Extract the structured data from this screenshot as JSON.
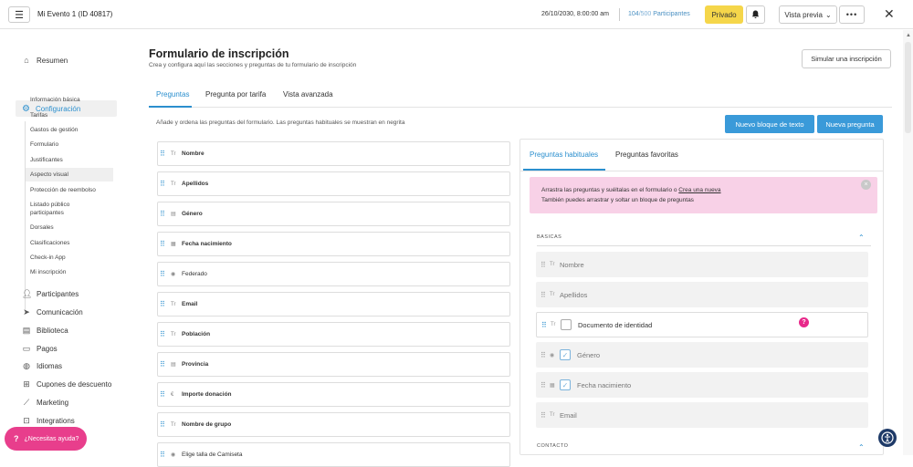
{
  "header": {
    "menu_icon": "hamburger-icon",
    "event_title": "Mi Evento 1 (ID 40817)",
    "datetime": "26/10/2030, 8:00:00 am",
    "participants_current": "104",
    "participants_total": "/500",
    "participants_label": "Participantes",
    "private_label": "Privado",
    "preview_label": "Vista previa",
    "more_label": "•••",
    "close_label": "✕"
  },
  "sidebar": {
    "resumen": "Resumen",
    "configuracion": "Configuración",
    "subitems": [
      "Información básica",
      "Tarifas",
      "Gastos de gestión",
      "Formulario",
      "Justificantes",
      "Aspecto visual",
      "Protección de reembolso",
      "Listado público",
      "participantes",
      "Dorsales",
      "Clasificaciones",
      "Check-in App",
      "Mi inscripción"
    ],
    "items": [
      "Participantes",
      "Comunicación",
      "Biblioteca",
      "Pagos",
      "Idiomas",
      "Cupones de descuento",
      "Marketing",
      "Integrations"
    ],
    "help": "¿Necesitas ayuda?"
  },
  "main": {
    "title": "Formulario de inscripción",
    "subtitle": "Crea y configura aquí las secciones y preguntas de tu formulario de inscripción",
    "simulate_button": "Simular una inscripción",
    "tabs": [
      "Preguntas",
      "Pregunta por tarifa",
      "Vista avanzada"
    ],
    "instruction": "Añade y ordena las preguntas del formulario. Las preguntas habituales se muestran en negrita",
    "new_text_block": "Nuevo bloque de texto",
    "new_question": "Nueva pregunta",
    "badge": "?",
    "left_questions": [
      {
        "label": "Nombre",
        "icon": "Tr",
        "bold": true
      },
      {
        "label": "Apellidos",
        "icon": "Tr",
        "bold": true
      },
      {
        "label": "Género",
        "icon": "▤",
        "bold": true
      },
      {
        "label": "Fecha nacimiento",
        "icon": "▦",
        "bold": true
      },
      {
        "label": "Federado",
        "icon": "◉",
        "bold": false
      },
      {
        "label": "Email",
        "icon": "Tr",
        "bold": true
      },
      {
        "label": "Población",
        "icon": "Tr",
        "bold": true
      },
      {
        "label": "Provincia",
        "icon": "▤",
        "bold": true
      },
      {
        "label": "Importe donación",
        "icon": "€",
        "bold": true
      },
      {
        "label": "Nombre de grupo",
        "icon": "Tr",
        "bold": true
      },
      {
        "label": "Elige talla de Camiseta",
        "icon": "◉",
        "bold": false
      }
    ]
  },
  "right_panel": {
    "tabs": [
      "Preguntas habituales",
      "Preguntas favoritas"
    ],
    "info_line1": "Arrastra las preguntas y suéltalas en el formulario o ",
    "info_link": "Crea una nueva",
    "info_line2": "También puedes arrastrar y soltar un bloque de preguntas",
    "close": "×",
    "section_basicas": "BASICAS",
    "section_contacto": "CONTACTO",
    "questions": [
      {
        "label": "Nombre",
        "icon": "Tr",
        "checkbox": false,
        "active": false
      },
      {
        "label": "Apellidos",
        "icon": "Tr",
        "checkbox": false,
        "active": false
      },
      {
        "label": "Documento de identidad",
        "icon": "Tr",
        "checkbox": true,
        "checked": false,
        "active": true
      },
      {
        "label": "Género",
        "icon": "◉",
        "checkbox": true,
        "checked": true,
        "active": false
      },
      {
        "label": "Fecha nacimiento",
        "icon": "▦",
        "checkbox": true,
        "checked": true,
        "active": false
      },
      {
        "label": "Email",
        "icon": "Tr",
        "checkbox": false,
        "active": false
      }
    ]
  },
  "colors": {
    "accent": "#2b8fce",
    "private": "#f5d64a",
    "help": "#e83e8c",
    "info_bg": "#f8d1e7",
    "button": "#3a9ad9"
  }
}
